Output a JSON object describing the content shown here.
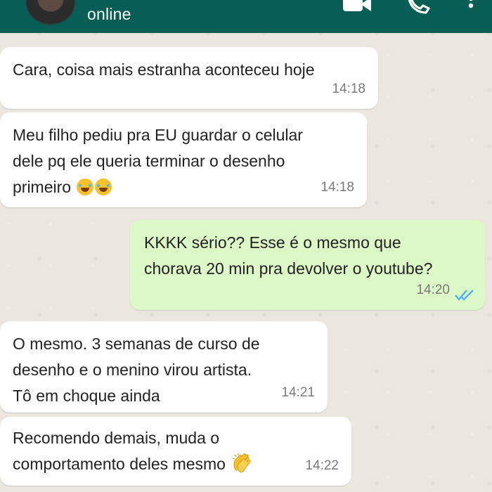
{
  "header": {
    "status": "online",
    "background": "#075e54",
    "icons": [
      "avatar",
      "video-call-icon",
      "voice-call-icon",
      "more-options-icon"
    ]
  },
  "messages": [
    {
      "direction": "incoming",
      "text": "Cara, coisa mais estranha aconteceu hoje",
      "time": "14:18"
    },
    {
      "direction": "incoming",
      "text": "Meu filho pediu pra EU guardar o celular\ndele pq ele queria terminar o desenho\nprimeiro",
      "emoji": "face-with-tears-of-joy x2",
      "time": "14:18"
    },
    {
      "direction": "outgoing",
      "text": "KKKK sério?? Esse é o mesmo que\nchorava 20 min pra devolver o youtube?",
      "time": "14:20",
      "read_receipt": "double-check-read"
    },
    {
      "direction": "incoming",
      "text": "O mesmo. 3 semanas de curso de\ndesenho e o menino virou artista.\nTô em choque ainda",
      "time": "14:21"
    },
    {
      "direction": "incoming",
      "text": "Recomendo demais, muda o\ncomportamento deles mesmo",
      "emoji": "clapping-hands",
      "time": "14:22"
    }
  ],
  "colors": {
    "incoming_bubble": "#ffffff",
    "outgoing_bubble": "#dcf8c6",
    "read_ticks": "#4fb3ef"
  }
}
